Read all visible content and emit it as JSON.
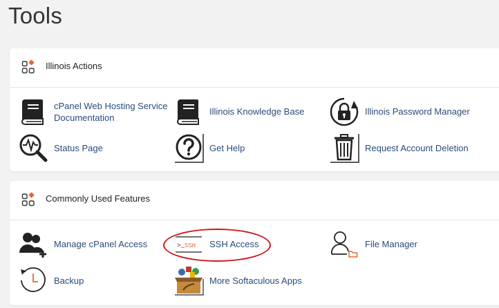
{
  "page": {
    "title": "Tools"
  },
  "panels": [
    {
      "title": "Illinois Actions",
      "items": [
        {
          "label": "cPanel Web Hosting Service",
          "label2": "Documentation",
          "icon": "book-icon"
        },
        {
          "label": "Illinois Knowledge Base",
          "icon": "book-icon"
        },
        {
          "label": "Illinois Password Manager",
          "icon": "lock-refresh-icon"
        },
        {
          "label": "Status Page",
          "icon": "magnifier-pulse-icon"
        },
        {
          "label": "Get Help",
          "icon": "question-icon"
        },
        {
          "label": "Request Account Deletion",
          "icon": "trash-icon"
        }
      ]
    },
    {
      "title": "Commonly Used Features",
      "items": [
        {
          "label": "Manage cPanel Access",
          "icon": "users-add-icon"
        },
        {
          "label": "SSH Access",
          "icon": "terminal-ssh-icon",
          "icon_text": ">_SSH"
        },
        {
          "label": "File Manager",
          "icon": "user-folder-icon"
        },
        {
          "label": "Backup",
          "icon": "clock-backup-icon"
        },
        {
          "label": "More Softaculous Apps",
          "icon": "softaculous-box-icon"
        }
      ]
    }
  ],
  "colors": {
    "link": "#2a4a7a",
    "accent_orange": "#e8662e",
    "highlight": "#d0161b"
  }
}
